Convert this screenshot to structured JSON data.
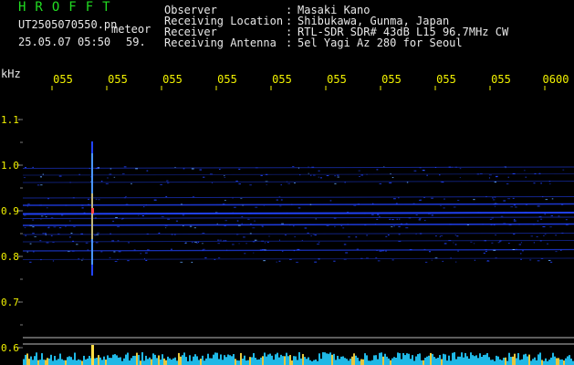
{
  "header": {
    "app_name": "HROFFT",
    "filename": "UT2505070550.pn",
    "tag": "meteor",
    "date_time": "25.05.07 05:50",
    "count": "59.",
    "info": [
      {
        "label": "Observer",
        "value": "Masaki Kano"
      },
      {
        "label": "Receiving Location",
        "value": "Shibukawa, Gunma, Japan"
      },
      {
        "label": "Receiver",
        "value": "RTL-SDR SDR# 43dB L15 96.7MHz CW"
      },
      {
        "label": "Receiving Antenna",
        "value": "5el Yagi Az 280 for Seoul"
      }
    ]
  },
  "time_axis": {
    "labels": [
      "055",
      "055",
      "055",
      "055",
      "055",
      "055",
      "055",
      "055",
      "055",
      "0600"
    ]
  },
  "freq_axis": {
    "unit": "kHz",
    "ticks": [
      "1.1",
      "1.0",
      "0.9",
      "0.8",
      "0.7",
      "0.6"
    ]
  },
  "colors": {
    "background": "#000000",
    "header_green": "#22dd22",
    "axis_yellow": "#f2f200",
    "signal_blue": "#2244ff",
    "meteor_mix": "#ffdd44",
    "noise_cyan": "#22ccff"
  }
}
